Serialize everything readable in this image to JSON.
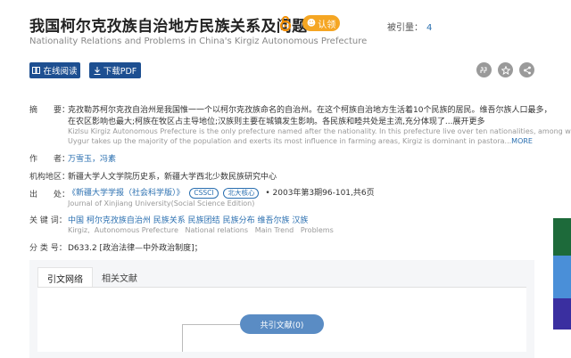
{
  "header": {
    "title": "我国柯尔克孜族自治地方民族关系及问题",
    "claim_label": "认领",
    "cited_label": "被引量：",
    "cited_count": "4",
    "subtitle": "Nationality Relations and Problems in China's Kirgiz Autonomous Prefecture"
  },
  "actions": {
    "read_online": "在线阅读",
    "download_pdf": "下载PDF"
  },
  "abstract": {
    "label": "摘　　要：",
    "line1": "克孜勒苏柯尔克孜自治州是我国惟一一个以柯尔克孜族命名的自治州。在这个柯族自治地方生活着10个民族的居民。维吾尔族人口最多，",
    "line2": "在农区影响也最大;柯族在牧区占主导地位;汉族则主要在城镇发生影响。各民族和睦共处是主流,充分体现了...展开更多",
    "en_line1": "Kizlsu Kirgiz Autonomous Prefecture is the only prefecture named after the nationality. In this prefecture live over ten nationalities, among whom",
    "en_line2": "Uygur takes up the majority of the population and exerts its most influence in farming areas, Kirgiz is dominant in pastora...",
    "en_more": "MORE"
  },
  "authors": {
    "label": "作　　者：",
    "value": "万雪玉，冯素"
  },
  "org": {
    "label": "机构地区：",
    "value": "新疆大学人文学院历史系，新疆大学西北少数民族研究中心"
  },
  "source": {
    "label": "出　　处：",
    "journal": "《新疆大学学报（社会科学版）》",
    "badge1": "CSSCI",
    "badge2": "北大核心",
    "issue": "• 2003年第3期96-101,共6页",
    "journal_en": "Journal of Xinjiang University(Social Science Edition)"
  },
  "keywords": {
    "label": "关 键 词：",
    "values": [
      "中国",
      "柯尔克孜族自治州",
      "民族关系",
      "民族团结",
      "民族分布",
      "维吾尔族",
      "汉族"
    ],
    "en_values": [
      "Kirgiz",
      "Autonomous Prefecture",
      "National relations",
      "Main Trend",
      "Problems"
    ]
  },
  "classification": {
    "label": "分 类 号：",
    "value": "D633.2 [政治法律—中外政治制度]；"
  },
  "tabs": {
    "citation_network": "引文网络",
    "related": "相关文献"
  },
  "graph": {
    "node_label": "共引文献(0)"
  },
  "colors": {
    "primary": "#1d4f91",
    "link": "#2a6fb0",
    "claim": "#f5a623",
    "oa": "#f08c00"
  }
}
